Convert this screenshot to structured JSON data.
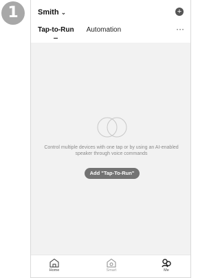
{
  "step": {
    "number": "1"
  },
  "header": {
    "home_name": "Smith",
    "tabs": [
      {
        "label": "Tap-to-Run",
        "active": true
      },
      {
        "label": "Automation",
        "active": false
      }
    ]
  },
  "empty_state": {
    "message": "Control multiple devices with one tap or by using an AI-enabled speaker through voice commands",
    "button_label": "Add \"Tap-To-Run\""
  },
  "tabbar": {
    "items": [
      {
        "label": "Home",
        "icon": "home-icon"
      },
      {
        "label": "Smart",
        "icon": "smart-icon"
      },
      {
        "label": "Me",
        "icon": "me-icon"
      }
    ]
  },
  "colors": {
    "background": "#f2f2f2",
    "button": "#737373",
    "badge": "#a8a8a8"
  }
}
